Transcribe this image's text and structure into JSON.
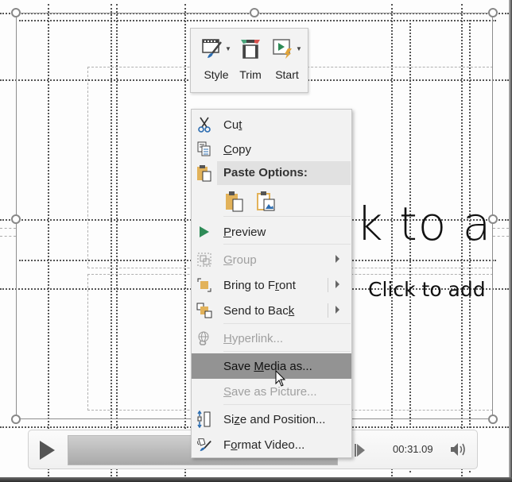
{
  "slide": {
    "title_placeholder": "k to a",
    "subtitle_placeholder": "Click to add"
  },
  "mini_toolbar": {
    "buttons": [
      {
        "label": "Style",
        "icon": "video-style-icon",
        "has_dropdown": true
      },
      {
        "label": "Trim",
        "icon": "trim-video-icon",
        "has_dropdown": false
      },
      {
        "label": "Start",
        "icon": "start-video-icon",
        "has_dropdown": true
      }
    ]
  },
  "context_menu": {
    "items": [
      {
        "label_pre": "Cu",
        "label_u": "t",
        "label_post": "",
        "icon": "scissors-icon",
        "enabled": true
      },
      {
        "label_pre": "",
        "label_u": "C",
        "label_post": "opy",
        "icon": "copy-icon",
        "enabled": true
      },
      {
        "label": "Paste Options:",
        "icon": "paste-icon",
        "type": "header"
      },
      {
        "label_pre": "",
        "label_u": "P",
        "label_post": "review",
        "icon": "play-preview-icon",
        "enabled": true
      },
      {
        "label_pre": "",
        "label_u": "G",
        "label_post": "roup",
        "icon": "group-icon",
        "enabled": false,
        "submenu": true
      },
      {
        "label_pre": "Bring to F",
        "label_u": "r",
        "label_post": "ont",
        "icon": "bring-to-front-icon",
        "enabled": true,
        "submenu": true
      },
      {
        "label_pre": "Send to Bac",
        "label_u": "k",
        "label_post": "",
        "icon": "send-to-back-icon",
        "enabled": true,
        "submenu": true
      },
      {
        "label_pre": "",
        "label_u": "H",
        "label_post": "yperlink...",
        "icon": "hyperlink-icon",
        "enabled": false
      },
      {
        "label_pre": "Save ",
        "label_u": "M",
        "label_post": "edia as...",
        "icon": "",
        "enabled": true,
        "highlighted": true
      },
      {
        "label_pre": "",
        "label_u": "S",
        "label_post": "ave as Picture...",
        "icon": "",
        "enabled": false
      },
      {
        "label_pre": "Si",
        "label_u": "z",
        "label_post": "e and Position...",
        "icon": "size-position-icon",
        "enabled": true
      },
      {
        "label_pre": "F",
        "label_u": "o",
        "label_post": "rmat Video...",
        "icon": "format-video-icon",
        "enabled": true
      }
    ]
  },
  "media_controls": {
    "time": "00:31.09",
    "play_icon": "play-icon",
    "volume_icon": "volume-icon"
  },
  "colors": {
    "menu_bg": "#f2f2f2",
    "highlight": "#939393",
    "paste_header_bg": "#e1e1e1",
    "disabled_text": "#a0a0a0",
    "icon_gold": "#e2b25a",
    "icon_blue": "#2b6cb0",
    "icon_green": "#2e8b57"
  }
}
